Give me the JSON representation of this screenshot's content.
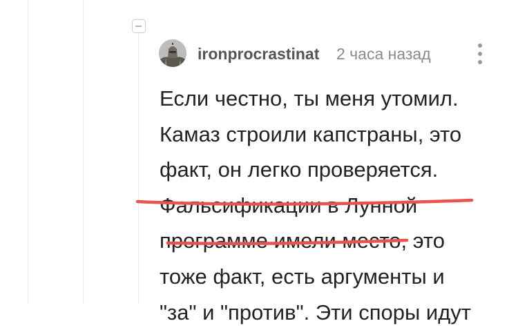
{
  "comment": {
    "author": "ironprocrastinat",
    "timestamp": "2 часа назад",
    "avatar_icon": "knight-avatar-icon",
    "collapse_icon": "minus-square-icon",
    "more_icon": "vertical-ellipsis-icon",
    "text_lines": [
      "Если честно, ты меня утомил.",
      "Камаз строили капстраны, это",
      "факт, он легко проверяется.",
      "Фальсификации в Лунной",
      "программе имели место, это",
      "тоже факт, есть аргументы и",
      "\"за\" и \"против\". Эти споры идут"
    ]
  },
  "highlight": {
    "color": "#e8534f",
    "marked_text": "Фальсификации в Лунной программе имели место"
  }
}
